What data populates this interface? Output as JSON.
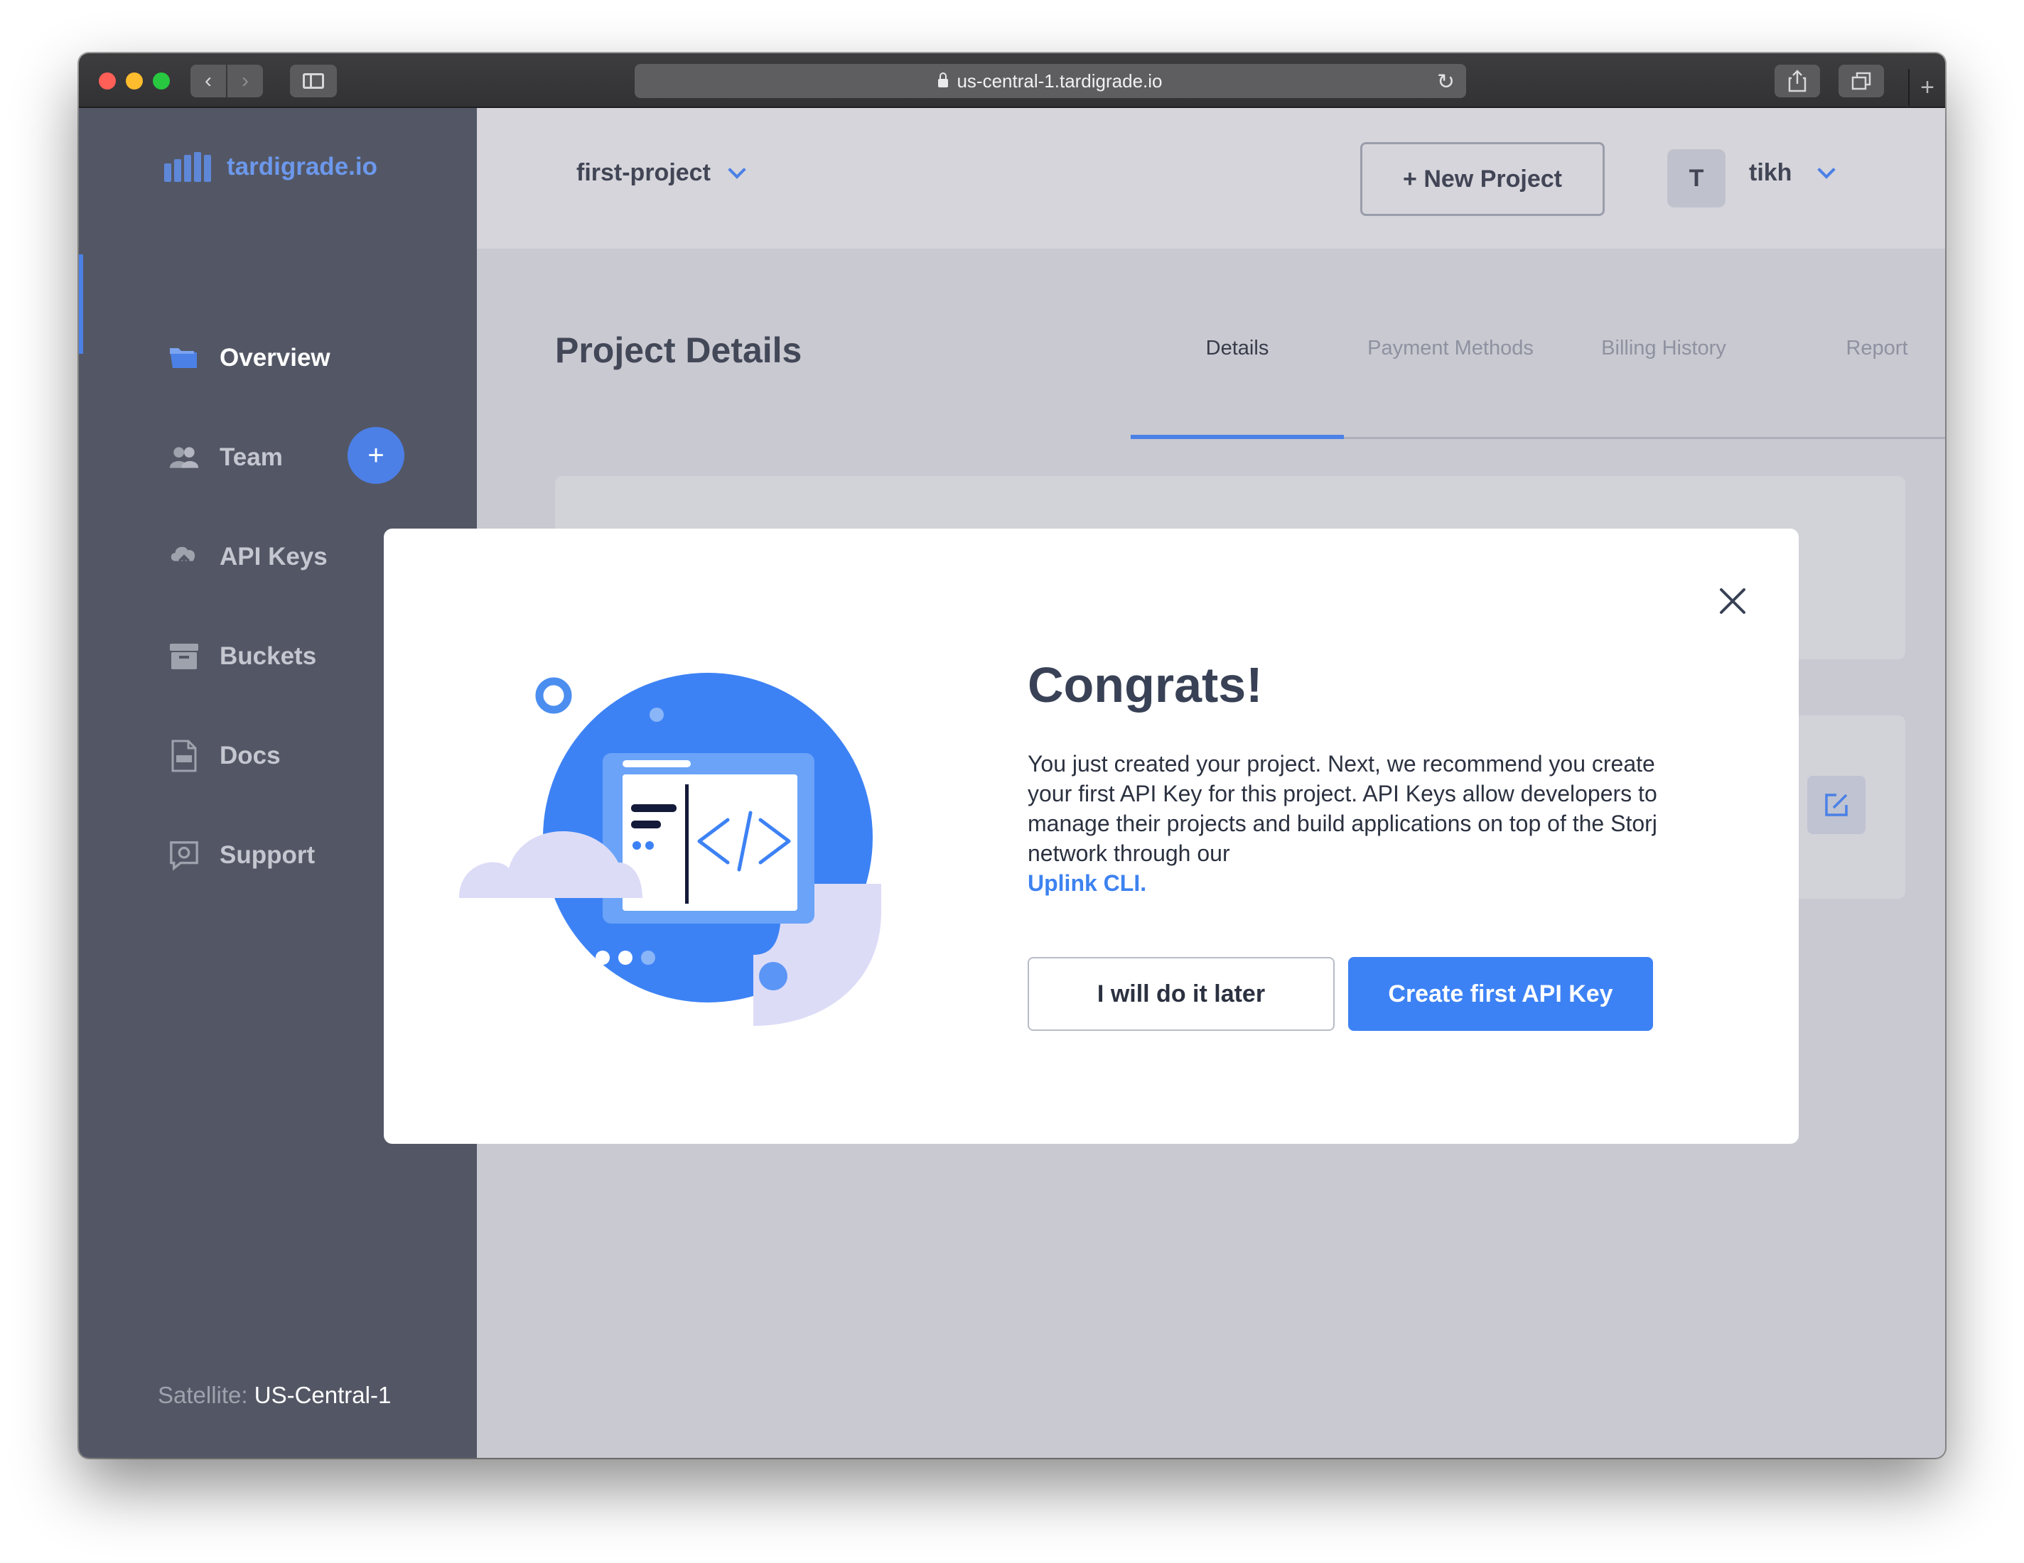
{
  "browser": {
    "url": "us-central-1.tardigrade.io",
    "back_icon": "chevron-left-icon",
    "forward_icon": "chevron-right-icon",
    "add_tab": "+"
  },
  "logo": {
    "text": "tardigrade.io",
    "color": "#6c98ec"
  },
  "sidebar": {
    "items": [
      {
        "label": "Overview",
        "icon": "folder-icon",
        "active": true
      },
      {
        "label": "Team",
        "icon": "team-icon"
      },
      {
        "label": "API Keys",
        "icon": "cloud-upload-icon"
      },
      {
        "label": "Buckets",
        "icon": "archive-box-icon"
      },
      {
        "label": "Docs",
        "icon": "document-icon"
      },
      {
        "label": "Support",
        "icon": "support-icon"
      }
    ],
    "add_team_label": "+",
    "satellite_label": "Satellite:",
    "satellite_value": "US-Central-1"
  },
  "header": {
    "project_name": "first-project",
    "new_project_label": "+ New Project",
    "avatar_initial": "T",
    "username": "tikh"
  },
  "page": {
    "title": "Project Details",
    "tabs": [
      "Details",
      "Payment Methods",
      "Billing History",
      "Report"
    ],
    "active_tab": "Details"
  },
  "modal": {
    "title": "Congrats!",
    "body": "You just created your project. Next, we recommend you create your first API Key for this project. API Keys allow developers to manage their projects and build applications on top of the Storj network through our",
    "link": "Uplink CLI.",
    "secondary_button": "I will do it later",
    "primary_button": "Create first API Key"
  },
  "colors": {
    "accent": "#3d82f5",
    "sidebar_bg": "#535765",
    "overlay_bg": "#c9c9d1"
  }
}
